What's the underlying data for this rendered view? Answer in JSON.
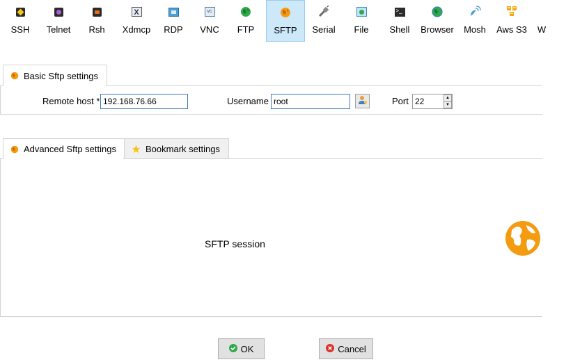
{
  "toolbar": {
    "items": [
      {
        "label": "SSH",
        "icon": "key-icon"
      },
      {
        "label": "Telnet",
        "icon": "telnet-icon"
      },
      {
        "label": "Rsh",
        "icon": "rsh-icon"
      },
      {
        "label": "Xdmcp",
        "icon": "xdmcp-icon"
      },
      {
        "label": "RDP",
        "icon": "rdp-icon"
      },
      {
        "label": "VNC",
        "icon": "vnc-icon"
      },
      {
        "label": "FTP",
        "icon": "ftp-globe-icon"
      },
      {
        "label": "SFTP",
        "icon": "sftp-globe-icon"
      },
      {
        "label": "Serial",
        "icon": "serial-plug-icon"
      },
      {
        "label": "File",
        "icon": "file-icon"
      },
      {
        "label": "Shell",
        "icon": "terminal-icon"
      },
      {
        "label": "Browser",
        "icon": "browser-globe-icon"
      },
      {
        "label": "Mosh",
        "icon": "satellite-icon"
      },
      {
        "label": "Aws S3",
        "icon": "aws-cubes-icon"
      },
      {
        "label": "W"
      }
    ],
    "selected": "SFTP"
  },
  "basic": {
    "tab_label": "Basic Sftp settings",
    "remote_host_label": "Remote host *",
    "remote_host_value": "192.168.76.66",
    "username_label": "Username",
    "username_value": "root",
    "port_label": "Port",
    "port_value": "22"
  },
  "advanced": {
    "tab_label": "Advanced Sftp settings",
    "bookmark_tab_label": "Bookmark settings",
    "session_text": "SFTP session"
  },
  "buttons": {
    "ok": "OK",
    "cancel": "Cancel"
  },
  "colors": {
    "accent_orange": "#f39c12",
    "selection_bg": "#cde8f9",
    "field_border": "#3d7bbf",
    "ok_green": "#2eaa4a",
    "cancel_red": "#d9342b"
  }
}
